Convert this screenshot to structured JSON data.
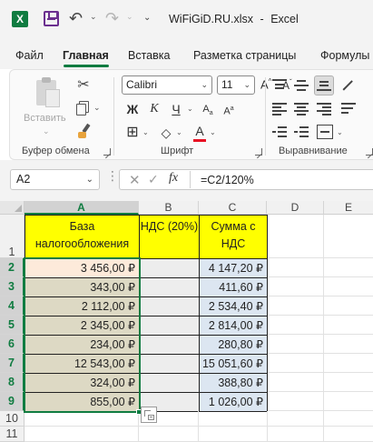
{
  "titlebar": {
    "filename": "WiFiGiD.RU.xlsx",
    "separator": "-",
    "app_name": "Excel",
    "icons": [
      "excel-logo",
      "save-icon",
      "undo-icon",
      "redo-icon",
      "customize-qat-icon"
    ]
  },
  "ribbon_tabs": [
    "Файл",
    "Главная",
    "Вставка",
    "Разметка страницы",
    "Формулы"
  ],
  "active_tab": "Главная",
  "clipboard": {
    "paste_label": "Вставить",
    "group_label": "Буфер обмена"
  },
  "font": {
    "font_name": "Calibri",
    "font_size": "11",
    "bold_label": "Ж",
    "italic_label": "К",
    "underline_label": "Ч",
    "grow_label": "A",
    "shrink_label": "A",
    "font_color_label": "A",
    "font_color": "#e81123",
    "group_label": "Шрифт"
  },
  "alignment": {
    "group_label": "Выравнивание"
  },
  "formula_bar": {
    "name_box": "A2",
    "fx_label": "fx",
    "formula": "=C2/120%"
  },
  "sheet": {
    "columns": [
      "A",
      "B",
      "C",
      "D",
      "E"
    ],
    "selected_column": "A",
    "rows": [
      "1",
      "2",
      "3",
      "4",
      "5",
      "6",
      "7",
      "8",
      "9",
      "10",
      "11"
    ],
    "header_row": {
      "a": "База налогообложения",
      "b": "НДС (20%)",
      "c": "Сумма с НДС"
    },
    "data": [
      {
        "a": "3 456,00 ₽",
        "b": "",
        "c": "4 147,20 ₽"
      },
      {
        "a": "343,00 ₽",
        "b": "",
        "c": "411,60 ₽"
      },
      {
        "a": "2 112,00 ₽",
        "b": "",
        "c": "2 534,40 ₽"
      },
      {
        "a": "2 345,00 ₽",
        "b": "",
        "c": "2 814,00 ₽"
      },
      {
        "a": "234,00 ₽",
        "b": "",
        "c": "280,80 ₽"
      },
      {
        "a": "12 543,00 ₽",
        "b": "",
        "c": "15 051,60 ₽"
      },
      {
        "a": "324,00 ₽",
        "b": "",
        "c": "388,80 ₽"
      },
      {
        "a": "855,00 ₽",
        "b": "",
        "c": "1 026,00 ₽"
      }
    ],
    "colors": {
      "header_fill": "#ffff00",
      "col_a_fill": "#ddd9c4",
      "active_cell_fill": "#fdeada",
      "col_b_fill": "#ededed",
      "col_c_fill": "#dce6f1",
      "selection": "#107c41"
    }
  }
}
